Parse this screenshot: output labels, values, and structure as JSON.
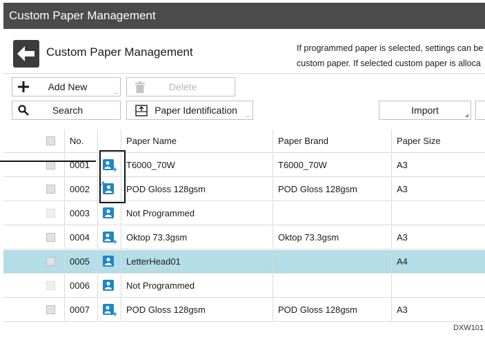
{
  "window": {
    "title": "Custom Paper Management"
  },
  "header": {
    "title": "Custom Paper Management",
    "message_line1": "If programmed paper is selected, settings can be",
    "message_line2": "custom paper. If selected custom paper is alloca"
  },
  "toolbar": {
    "add_new": "Add New",
    "delete": "Delete",
    "search": "Search",
    "paper_identification": "Paper Identification",
    "import": "Import"
  },
  "table": {
    "columns": {
      "no": "No.",
      "paper_name": "Paper Name",
      "paper_brand": "Paper Brand",
      "paper_size": "Paper Size"
    },
    "rows": [
      {
        "no": "0001",
        "name": "T6000_70W",
        "brand": "T6000_70W",
        "size": "A3",
        "icon": "user-plus-icon"
      },
      {
        "no": "0002",
        "name": "POD Gloss 128gsm",
        "brand": "POD Gloss 128gsm",
        "size": "A3",
        "icon": "user-import-icon"
      },
      {
        "no": "0003",
        "name": "Not Programmed",
        "brand": "",
        "size": "",
        "icon": "user-icon"
      },
      {
        "no": "0004",
        "name": "Oktop 73.3gsm",
        "brand": "Oktop 73.3gsm",
        "size": "A3",
        "icon": "user-plus-icon"
      },
      {
        "no": "0005",
        "name": "LetterHead01",
        "brand": "",
        "size": "A4",
        "icon": "user-icon",
        "selected": true
      },
      {
        "no": "0006",
        "name": "Not Programmed",
        "brand": "",
        "size": "",
        "icon": "user-icon"
      },
      {
        "no": "0007",
        "name": "POD Gloss 128gsm",
        "brand": "POD Gloss 128gsm",
        "size": "A3",
        "icon": "user-plus-icon"
      }
    ]
  },
  "figure_ref": "DXW101",
  "colors": {
    "titlebar": "#4b4b4b",
    "selected_row": "#b4dde6",
    "icon_blue": "#1f86c8"
  }
}
